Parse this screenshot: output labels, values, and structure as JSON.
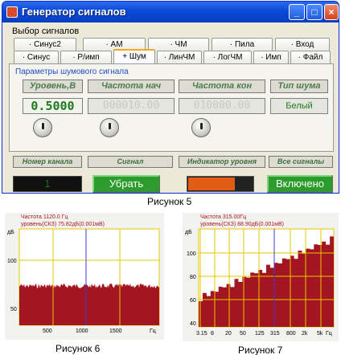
{
  "window": {
    "title": "Генератор сигналов",
    "controls": {
      "minimize": "_",
      "maximize": "□",
      "close": "×"
    }
  },
  "signal_selection": {
    "label": "Выбор сигналов",
    "tabs_row1": [
      "· Синус2",
      "· АМ",
      "· ЧМ",
      "· Пила",
      "· Вход"
    ],
    "tabs_row2": [
      "· Синус",
      "· Р/имп",
      "+ Шум",
      "· ЛинЧМ",
      "· ЛогЧМ",
      "· Имп",
      "· Файл"
    ],
    "active_tab": "+ Шум"
  },
  "noise_params": {
    "title": "Параметры шумового сигнала",
    "headers": [
      "Уровень,В",
      "Частота нач",
      "Частота кон",
      "Тип шума"
    ],
    "level": "0.5000",
    "freq_start": "000010.00",
    "freq_end": "010000.00",
    "noise_type": "Белый"
  },
  "channel_section": {
    "headers": [
      "Номер канала",
      "Сигнал",
      "Индикатор уровня",
      "Все сигналы"
    ],
    "channel_number": "1",
    "remove_button": "Убрать",
    "level_indicator": 0.72,
    "all_signals_button": "Включено"
  },
  "captions": {
    "fig5": "Рисунок 5",
    "fig6": "Рисунок 6",
    "fig7": "Рисунок 7"
  },
  "colors": {
    "fill": "#a31621",
    "grid": "#e8c800",
    "marker": "#3b3bd9",
    "info_text": "#b01818"
  },
  "plot6": {
    "info_line1": "Частота   1120.0 Гц",
    "info_line2": "уровень(СКЗ)  75.82дБ(0.001мВ)",
    "y_unit": "дБ",
    "y_ticks": [
      "100",
      "50"
    ],
    "x_ticks": [
      "500",
      "1000",
      "1500"
    ],
    "x_unit": "Гц"
  },
  "plot7": {
    "info_line1": "Частота   315.00Гц",
    "info_line2": "уровень(СКЗ)  88.90дБ(0.001мВ)",
    "y_unit": "дБ",
    "y_ticks": [
      "100",
      "80",
      "60",
      "40"
    ],
    "x_ticks": [
      "3.15",
      "8",
      "20",
      "50",
      "125",
      "315",
      "800",
      "2k",
      "5k"
    ],
    "x_unit": "Гц"
  }
}
